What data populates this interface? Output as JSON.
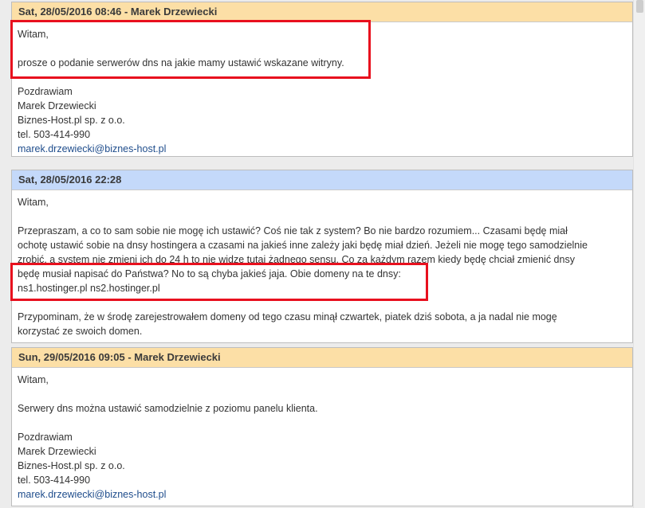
{
  "messages": [
    {
      "header": "Sat, 28/05/2016 08:46 - Marek Drzewiecki",
      "greeting": "Witam,",
      "text": "prosze o podanie serwerów dns na jakie mamy ustawić wskazane witryny.",
      "sig_closing": "Pozdrawiam",
      "sig_name": "Marek Drzewiecki",
      "sig_company": "Biznes-Host.pl sp. z o.o.",
      "sig_phone": "tel. 503-414-990",
      "sig_email": "marek.drzewiecki@biznes-host.pl"
    },
    {
      "header": "Sat, 28/05/2016 22:28",
      "greeting": "Witam,",
      "lines": [
        "Przepraszam, a co to sam sobie nie mogę ich ustawić? Coś nie tak z system? Bo nie bardzo rozumiem... Czasami będę miał",
        "ochotę ustawić sobie na dnsy hostingera a czasami na jakieś inne zależy jaki będę miał dzień. Jeżeli nie mogę tego samodzielnie",
        "zrobić, a system nie zmieni ich do 24 h to nie widze tutaj żadnego sensu. Co za każdym razem kiedy będę chciał zmienić dnsy",
        "będę musiał napisać do Państwa? No to są chyba jakieś jaja. Obie domeny na te dnsy:",
        "ns1.hostinger.pl ns2.hostinger.pl"
      ],
      "lines2": [
        "Przypominam, że w środę zarejestrowałem domeny od tego czasu minął czwartek, piatek dziś sobota, a ja nadal nie mogę",
        "korzystać ze swoich domen."
      ]
    },
    {
      "header": "Sun, 29/05/2016 09:05 - Marek Drzewiecki",
      "greeting": "Witam,",
      "text": "Serwery dns można ustawić samodzielnie z poziomu panelu klienta.",
      "sig_closing": "Pozdrawiam",
      "sig_name": "Marek Drzewiecki",
      "sig_company": "Biznes-Host.pl sp. z o.o.",
      "sig_phone": "tel. 503-414-990",
      "sig_email": "marek.drzewiecki@biznes-host.pl"
    }
  ],
  "colors": {
    "staff_header": "#fcdfa6",
    "client_header": "#c4d9fa",
    "highlight": "#e8101e",
    "link": "#1f4d8c"
  }
}
